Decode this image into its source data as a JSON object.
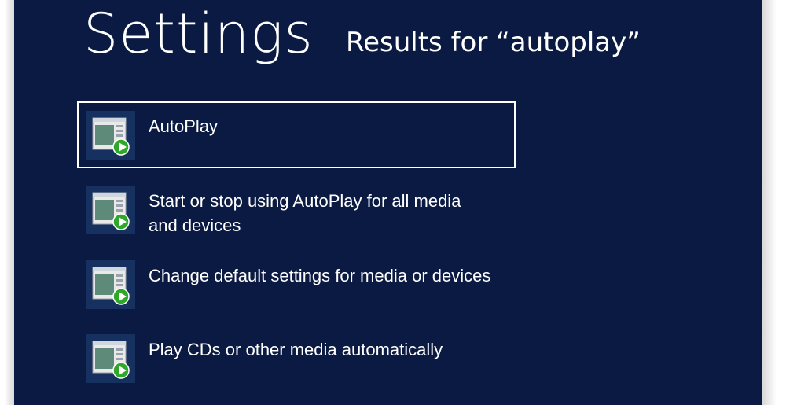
{
  "header": {
    "title": "Settings",
    "subtitle": "Results for “autoplay”"
  },
  "results": [
    {
      "label": "AutoPlay",
      "icon": "autoplay-settings-icon",
      "selected": true
    },
    {
      "label": "Start or stop using AutoPlay for all media and devices",
      "icon": "autoplay-settings-icon",
      "selected": false
    },
    {
      "label": "Change default settings for media or devices",
      "icon": "autoplay-settings-icon",
      "selected": false
    },
    {
      "label": "Play CDs or other media automatically",
      "icon": "autoplay-settings-icon",
      "selected": false
    }
  ],
  "colors": {
    "background": "#0b1a42",
    "tile": "#16305f",
    "play": "#2fa82a",
    "text": "#ffffff"
  }
}
